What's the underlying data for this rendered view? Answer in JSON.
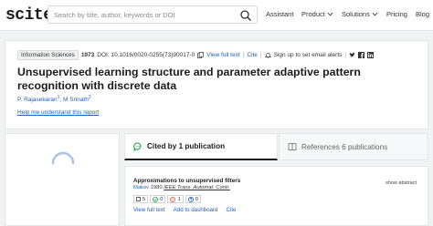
{
  "header": {
    "logo": "scite_",
    "search_placeholder": "Search by title, author, keywords or DOI",
    "nav": [
      {
        "label": "Assistant"
      },
      {
        "label": "Product"
      },
      {
        "label": "Solutions"
      },
      {
        "label": "Pricing"
      },
      {
        "label": "Blog"
      }
    ]
  },
  "paper": {
    "journal": "Information Sciences",
    "year": "1973",
    "doi": "DOI: 10.1016/0020-0255(73)90017-0",
    "view_full_text": "View full text",
    "cite": "Cite",
    "alerts": "Sign up to set email alerts",
    "title": "Unsupervised learning structure and parameter adaptive pattern recognition with discrete data",
    "authors": [
      {
        "name": "P. Rajasekaran",
        "sup": "1"
      },
      {
        "name": "M Srinath",
        "sup": "2"
      }
    ],
    "help_link": "Help me understand this report"
  },
  "tabs": {
    "cited_by": "Cited by 1 publication",
    "references": "References 6 publications"
  },
  "citing": {
    "title": "Approximations to unsupervised filters",
    "author": "Makov",
    "year": "1980",
    "journal": "IEEE Trans. Automat. Contr.",
    "show_abstract": "show abstract",
    "counts": {
      "mentioning": "5",
      "supporting": "0",
      "contrasting": "1",
      "unclassified": "0"
    },
    "actions": {
      "view_full_text": "View full text",
      "add_dashboard": "Add to dashboard",
      "cite": "Cite"
    }
  },
  "colors": {
    "link": "#1f5fbf",
    "supporting": "#2ea44f",
    "contrasting": "#e0573f",
    "unclassified": "#1f5fbf"
  }
}
